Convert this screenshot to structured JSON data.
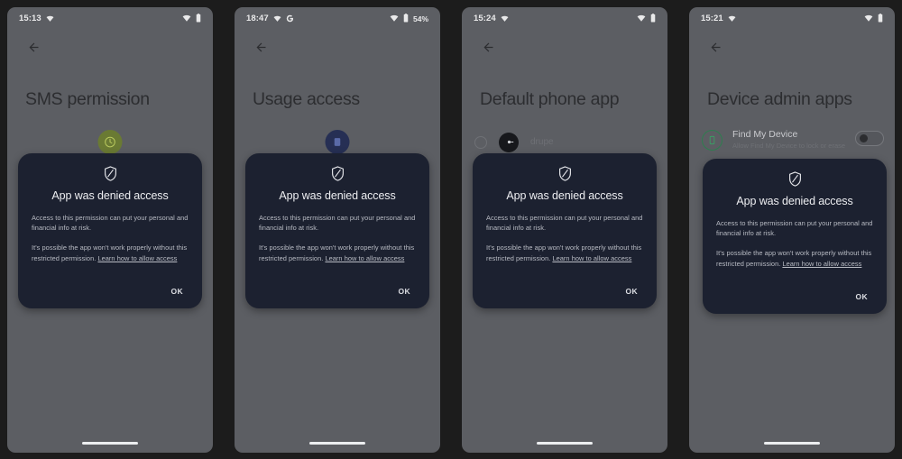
{
  "dialog": {
    "icon": "shield-slash-icon",
    "title": "App was denied access",
    "paragraph1": "Access to this permission can put your personal and financial info at risk.",
    "paragraph2_before": "It's possible the app won't work properly without this restricted permission. ",
    "link_text": "Learn how to allow access",
    "ok_label": "OK",
    "bg_color": "#1c2130"
  },
  "screens": [
    {
      "status": {
        "time": "15:13",
        "wifi": "wifi-icon",
        "battery": "battery-icon",
        "battery_pct": ""
      },
      "back": "back-arrow-icon",
      "title": "SMS permission",
      "bg_type": "app-icon",
      "app_icon": {
        "name": "sms-app-icon",
        "color": "#6a7a33"
      }
    },
    {
      "status": {
        "time": "18:47",
        "wifi": "wifi-icon",
        "google": "google-g-icon",
        "battery": "battery-icon",
        "battery_pct": "54%"
      },
      "back": "back-arrow-icon",
      "title": "Usage access",
      "bg_type": "app-icon",
      "app_icon": {
        "name": "usage-app-icon",
        "color": "#262f54"
      }
    },
    {
      "status": {
        "time": "15:24",
        "wifi": "wifi-icon",
        "battery": "battery-icon",
        "battery_pct": ""
      },
      "back": "back-arrow-icon",
      "title": "Default phone app",
      "bg_type": "radio-list",
      "row": {
        "radio": "radio-unselected-icon",
        "icon": "drupe-app-icon",
        "label": "drupe"
      }
    },
    {
      "status": {
        "time": "15:21",
        "wifi": "wifi-icon",
        "battery": "battery-icon",
        "battery_pct": ""
      },
      "back": "back-arrow-icon",
      "title": "Device admin apps",
      "bg_type": "admin-list",
      "row": {
        "icon": "find-my-device-icon",
        "title": "Find My Device",
        "subtitle": "Allow Find My Device to lock or erase a",
        "toggle": "off"
      }
    }
  ]
}
